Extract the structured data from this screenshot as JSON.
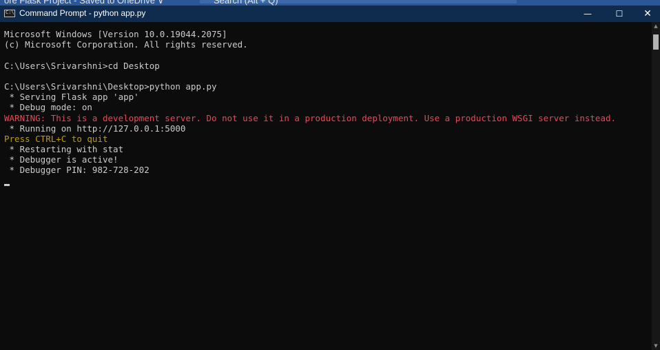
{
  "background_window": {
    "title_fragment": "ore Flask Project - Saved to OneDrive ∨",
    "search_fragment": "Search (Alt + Q)"
  },
  "window": {
    "title": "Command Prompt - python  app.py",
    "icon": "cmd-icon",
    "minimize_glyph": "—",
    "maximize_glyph": "☐",
    "close_glyph": "✕"
  },
  "terminal": {
    "lines": [
      {
        "text": "Microsoft Windows [Version 10.0.19044.2075]",
        "color": "#cccccc"
      },
      {
        "text": "(c) Microsoft Corporation. All rights reserved.",
        "color": "#cccccc"
      },
      {
        "text": "",
        "color": "#cccccc"
      },
      {
        "text": "C:\\Users\\Srivarshni>cd Desktop",
        "color": "#cccccc"
      },
      {
        "text": "",
        "color": "#cccccc"
      },
      {
        "text": "C:\\Users\\Srivarshni\\Desktop>python app.py",
        "color": "#cccccc"
      },
      {
        "text": " * Serving Flask app 'app'",
        "color": "#cccccc"
      },
      {
        "text": " * Debug mode: on",
        "color": "#cccccc"
      },
      {
        "text": "WARNING: This is a development server. Do not use it in a production deployment. Use a production WSGI server instead.",
        "color": "#e74856"
      },
      {
        "text": " * Running on http://127.0.0.1:5000",
        "color": "#cccccc"
      },
      {
        "text": "Press CTRL+C to quit",
        "color": "#c19c00"
      },
      {
        "text": " * Restarting with stat",
        "color": "#cccccc"
      },
      {
        "text": " * Debugger is active!",
        "color": "#cccccc"
      },
      {
        "text": " * Debugger PIN: 982-728-202",
        "color": "#cccccc"
      }
    ]
  },
  "colors": {
    "terminal_bg": "#0c0c0c",
    "titlebar_bg": "#0f2b4d",
    "text_default": "#cccccc",
    "warning": "#e74856",
    "notice": "#c19c00"
  }
}
